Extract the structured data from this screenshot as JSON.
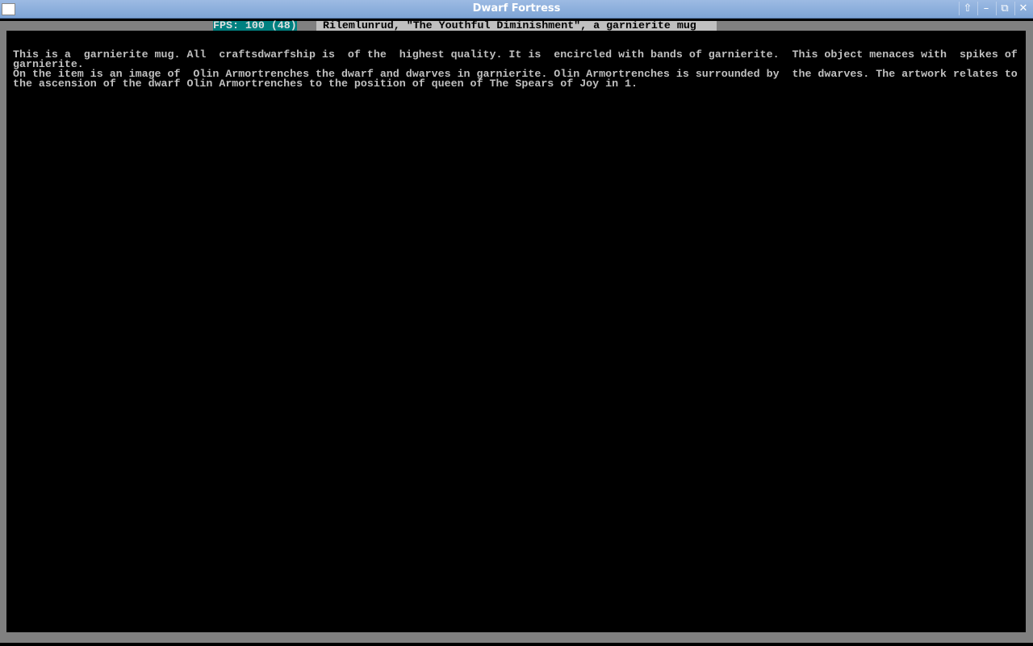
{
  "window": {
    "title": "Dwarf Fortress",
    "buttons": [
      "up",
      "minimize",
      "restore",
      "close"
    ]
  },
  "header": {
    "fps": "FPS: 100 (48)",
    "item_title": " Rilemlunrud, \"The Youthful Diminishment\", a garnierite mug "
  },
  "description": {
    "lines": [
      "This is a  garnierite mug. All  craftsdwarfship is  of the  highest quality. It is  encircled with bands of garnierite.  This object menaces with  spikes of",
      "garnierite.",
      "On the item is an image of  Olin Armortrenches the dwarf and dwarves in garnierite. Olin Armortrenches is surrounded by  the dwarves. The artwork relates to",
      "the ascension of the dwarf Olin Armortrenches to the position of queen of The Spears of Joy in 1."
    ]
  },
  "colors": {
    "fps_bg": "#008080",
    "title_bg": "#c0c0c0",
    "text": "#c0c0c0",
    "frame": "#808080"
  }
}
